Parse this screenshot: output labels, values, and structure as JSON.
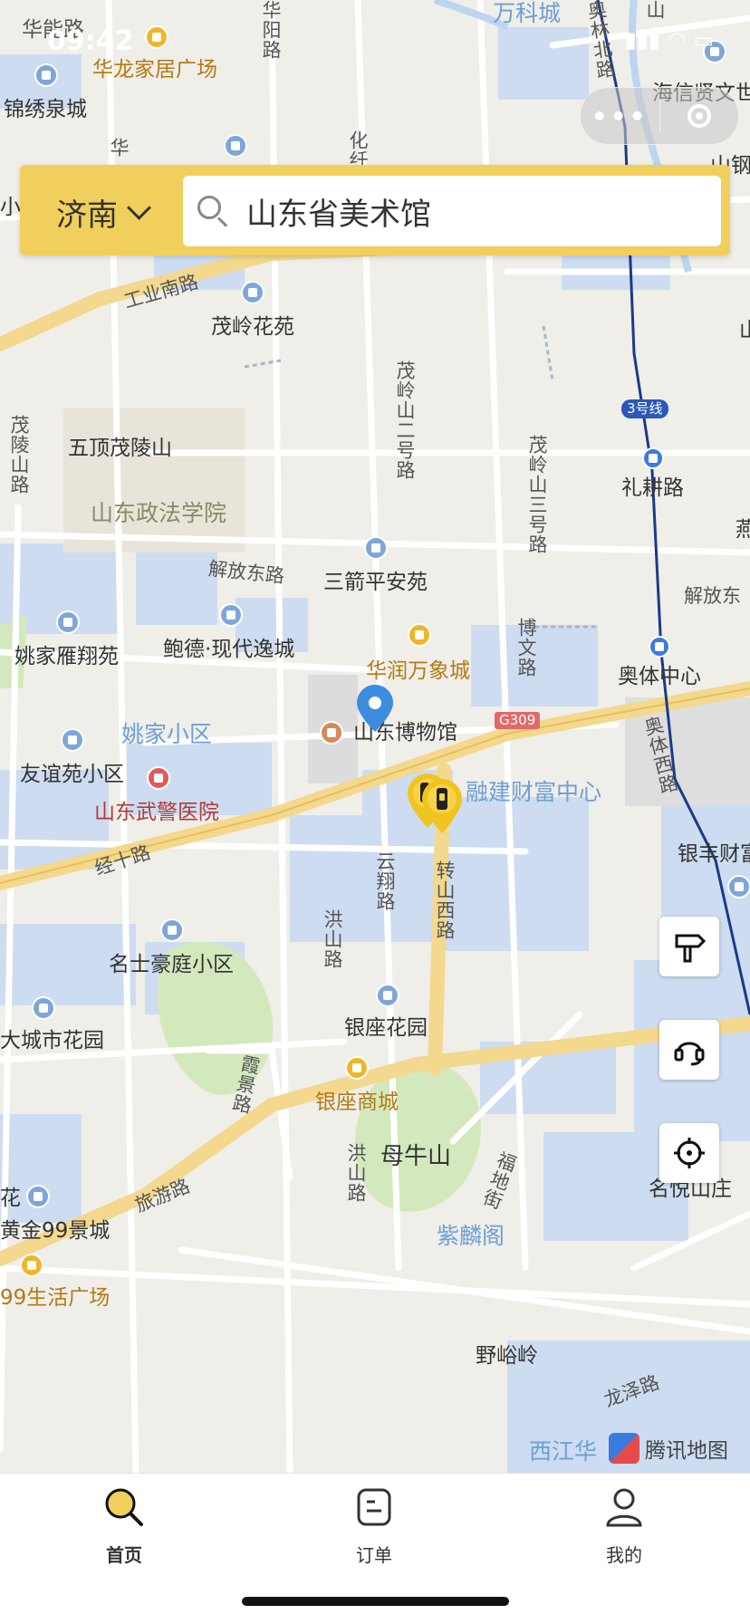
{
  "status_bar": {
    "time": "09:42"
  },
  "search": {
    "city": "济南",
    "query": "山东省美术馆"
  },
  "map": {
    "labels": {
      "hualong": "华龙家居广场",
      "jinxiu": "锦绣泉城",
      "hainengl": "华能路",
      "wanke": "万科城",
      "haixin": "海信贤文世",
      "shangang": "山钢",
      "gongye": "工业南路",
      "maoling_huayuan": "茂岭花苑",
      "wuding": "五顶茂陵山",
      "zhengfa": "山东政法学院",
      "jiefang_e": "解放东路",
      "sanjian": "三箭平安苑",
      "jiefang_e2": "解放东",
      "yaojia_yanxiang": "姚家雁翔苑",
      "baode": "鲍德·现代逸城",
      "huarun": "华润万象城",
      "aoti": "奥体中心",
      "liegeng": "礼耕路",
      "yaojia": "姚家小区",
      "museum": "山东博物馆",
      "youyi": "友谊苑小区",
      "wujing": "山东武警医院",
      "rongjian": "融建财富中心",
      "g309": "G309",
      "jingshi": "经十路",
      "yinfeng": "银丰财富",
      "mingshi": "名士豪庭小区",
      "dacheng": "大城市花园",
      "yinzuo_garden": "银座花园",
      "yinzuo_mall": "银座商城",
      "muniu": "母牛山",
      "lvyou": "旅游路",
      "huangjin": "黄金99景城",
      "shenghuo": "99生活广场",
      "zilin": "紫麟阁",
      "mingyue": "名悦山庄",
      "yeyu": "野峪岭",
      "longze": "龙泽路",
      "xijiang": "西江华",
      "line3": "3号线",
      "hualiang_v": "华阳路",
      "hua_v2": "华",
      "hua_v3": "化纤",
      "maoling_mt2": "茂岭山二号路",
      "maoling_mt3": "茂岭山三号路",
      "maoling_mt": "茂陵山路",
      "bowen": "博文路",
      "aotixi": "奥体西路",
      "olinbei": "奥林北路",
      "yunxiang": "云翔路",
      "zhuanshan": "转山西路",
      "hongshan": "洪山路",
      "xiajing": "霞景路",
      "hongshan2": "洪山路",
      "fudi": "福地街",
      "shan_top": "山",
      "xiao": "小区",
      "shan_w": "山",
      "yan": "燕",
      "hua_sm": "花"
    }
  },
  "attribution": "腾讯地图",
  "nav": [
    {
      "label": "首页",
      "icon": "search-icon",
      "active": true
    },
    {
      "label": "订单",
      "icon": "order-icon",
      "active": false
    },
    {
      "label": "我的",
      "icon": "user-icon",
      "active": false
    }
  ],
  "colors": {
    "accent": "#f1cf5c",
    "road_major": "#f6dc96",
    "water": "#c9dcf2",
    "green": "#cfe8b5",
    "metro": "#1a3a8a"
  }
}
